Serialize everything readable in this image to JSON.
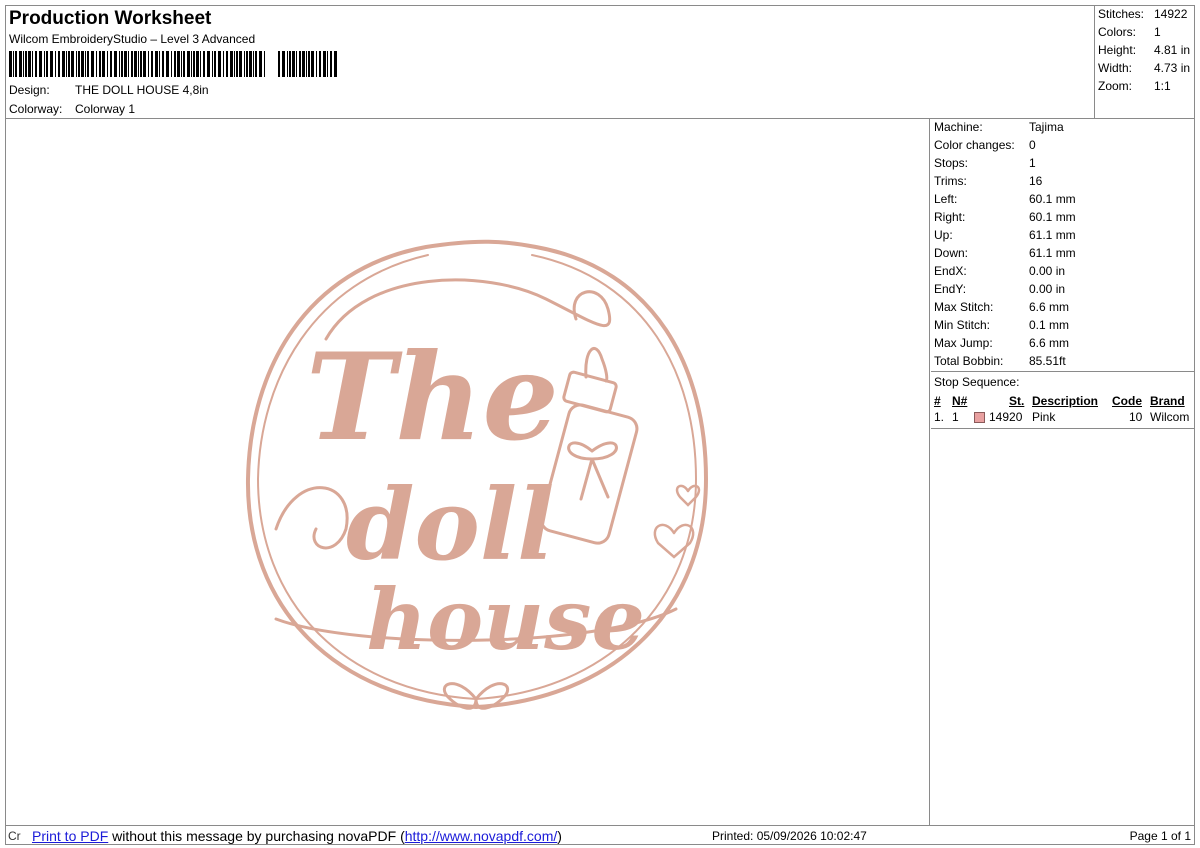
{
  "header": {
    "title": "Production Worksheet",
    "software": "Wilcom EmbroideryStudio – Level 3 Advanced",
    "design_label": "Design:",
    "design_value": "THE DOLL HOUSE  4,8in",
    "colorway_label": "Colorway:",
    "colorway_value": "Colorway 1"
  },
  "summary": {
    "stitches_label": "Stitches:",
    "stitches": "14922",
    "colors_label": "Colors:",
    "colors": "1",
    "height_label": "Height:",
    "height": "4.81 in",
    "width_label": "Width:",
    "width": "4.73 in",
    "zoom_label": "Zoom:",
    "zoom": "1:1"
  },
  "machine_info": [
    {
      "label": "Machine:",
      "value": "Tajima"
    },
    {
      "label": "Color changes:",
      "value": "0"
    },
    {
      "label": "Stops:",
      "value": "1"
    },
    {
      "label": "Trims:",
      "value": "16"
    },
    {
      "label": "Left:",
      "value": "60.1 mm"
    },
    {
      "label": "Right:",
      "value": "60.1 mm"
    },
    {
      "label": "Up:",
      "value": "61.1 mm"
    },
    {
      "label": "Down:",
      "value": "61.1 mm"
    },
    {
      "label": "EndX:",
      "value": "0.00 in"
    },
    {
      "label": "EndY:",
      "value": "0.00 in"
    },
    {
      "label": "Max Stitch:",
      "value": "6.6 mm"
    },
    {
      "label": "Min Stitch:",
      "value": "0.1 mm"
    },
    {
      "label": "Max Jump:",
      "value": "6.6 mm"
    },
    {
      "label": "Total Bobbin:",
      "value": "85.51ft"
    }
  ],
  "stop_sequence": {
    "label": "Stop Sequence:",
    "headers": {
      "num": "#",
      "n": "N#",
      "st": "St.",
      "description": "Description",
      "code": "Code",
      "brand": "Brand"
    },
    "rows": [
      {
        "num": "1.",
        "n": "1",
        "swatch_color": "#e8a0a0",
        "st": "14920",
        "description": "Pink",
        "code": "10",
        "brand": "Wilcom"
      }
    ]
  },
  "artwork": {
    "line1": "The",
    "line2": "doll",
    "line3": "house",
    "thread_color": "#d9a796"
  },
  "footer": {
    "cut_text": "Cr",
    "link_text": "Print to PDF",
    "message": " without this message by purchasing novaPDF (",
    "url": "http://www.novapdf.com/",
    "message_end": ")",
    "printed": "Printed: 05/09/2026 10:02:47",
    "page": "Page 1 of 1"
  }
}
